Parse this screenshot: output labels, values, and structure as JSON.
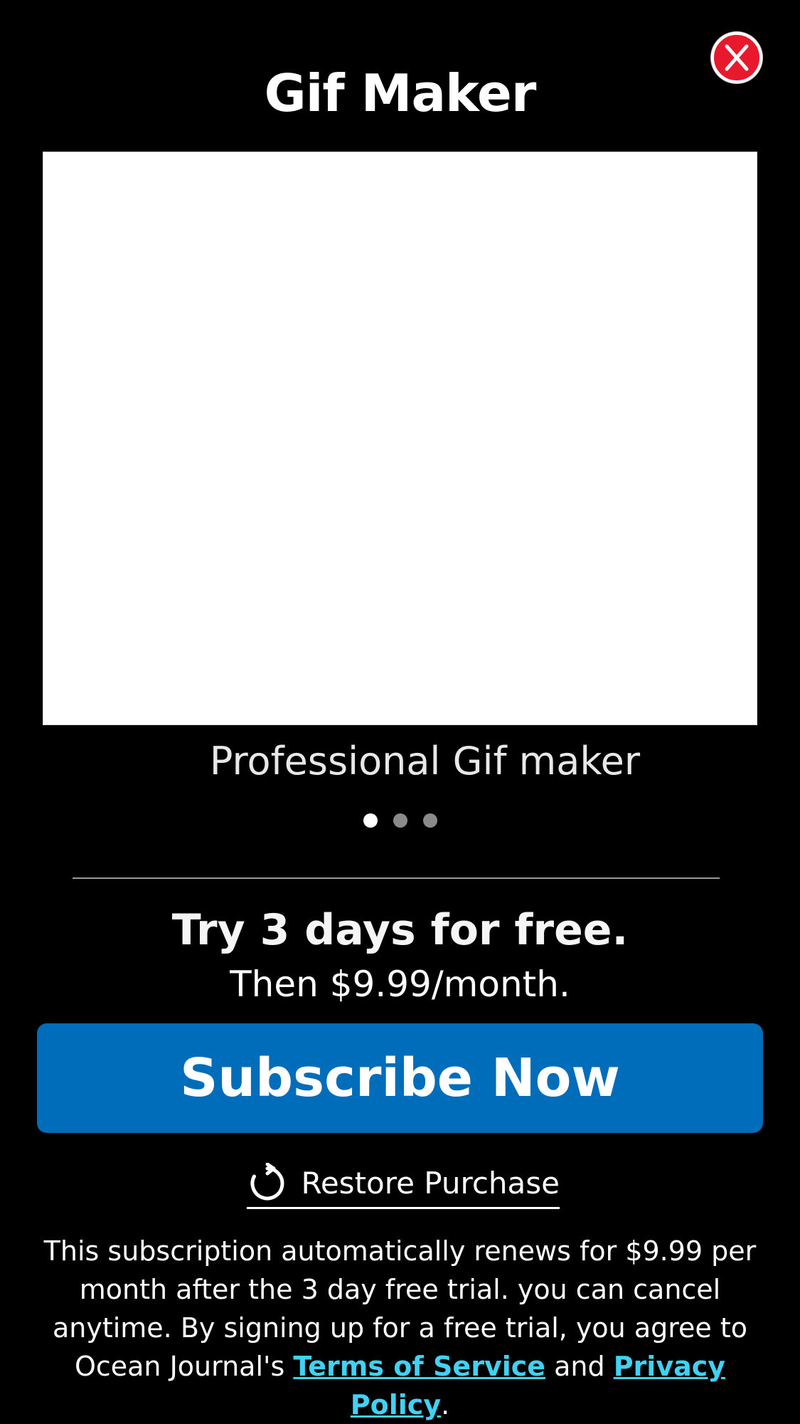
{
  "colors": {
    "background": "#000000",
    "close_button": "#e8192c",
    "subscribe_button": "#006dba",
    "link": "#3fd2f2"
  },
  "header": {
    "title": "Gif Maker",
    "close_icon": "close-x-icon"
  },
  "carousel": {
    "caption": "Professional Gif maker",
    "page_count": 3,
    "active_page": 1
  },
  "offer": {
    "headline": "Try 3 days for free.",
    "price": "Then $9.99/month."
  },
  "actions": {
    "subscribe_label": "Subscribe Now",
    "restore_label": "Restore Purchase",
    "restore_icon": "refresh-icon"
  },
  "legal": {
    "text_before": "This subscription automatically renews for $9.99 per month after the 3 day free trial. you can cancel anytime. By signing up for a free trial, you agree to Ocean Journal's ",
    "terms_label": "Terms of Service",
    "text_between": " and ",
    "privacy_label": "Privacy Policy",
    "text_after": "."
  }
}
